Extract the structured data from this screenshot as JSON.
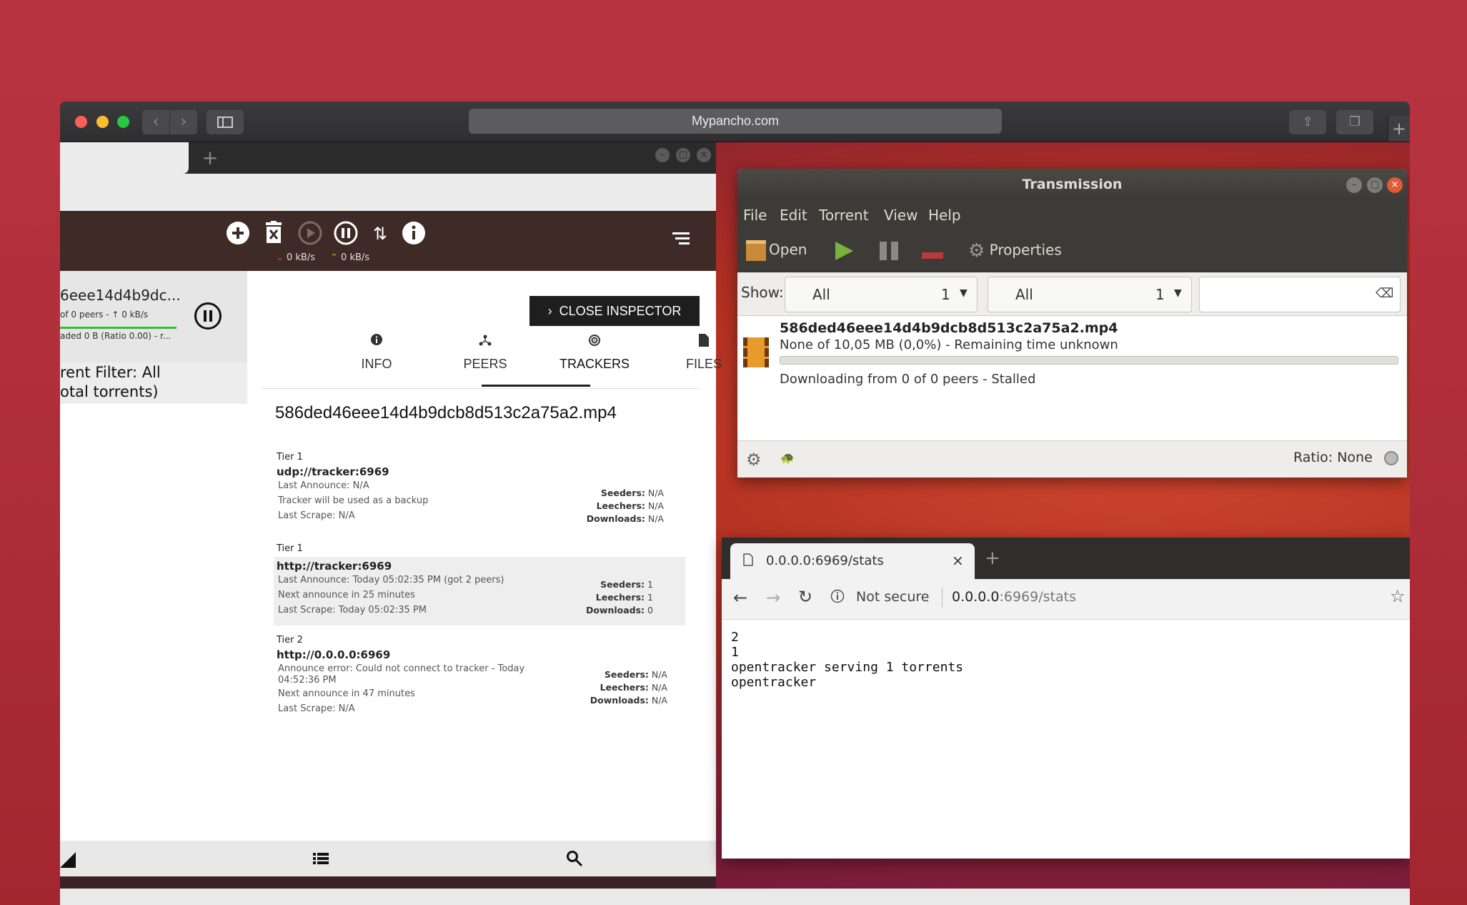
{
  "browser": {
    "url": "Mypancho.com",
    "new_tab": "+"
  },
  "left_app": {
    "tab_plus": "+",
    "toolbar": {
      "download_speed": "0 kB/s",
      "upload_speed": "0 kB/s"
    },
    "torrent": {
      "name": "6eee14d4b9dc...",
      "peers": "of 0 peers - ↑ 0 kB/s",
      "uploaded": "aded 0 B (Ratio 0.00) - r..."
    },
    "filter": {
      "line1": "rent Filter: All",
      "line2": "otal torrents)"
    },
    "inspector": {
      "close_label": "CLOSE INSPECTOR",
      "tabs": [
        "INFO",
        "PEERS",
        "TRACKERS",
        "FILES"
      ],
      "active_tab": "TRACKERS",
      "title": "586ded46eee14d4b9dcb8d513c2a75a2.mp4",
      "trackers": [
        {
          "tier": "Tier 1",
          "url": "udp://tracker:6969",
          "lines": [
            "Last Announce: N/A",
            "Tracker will be used as a backup",
            "Last Scrape: N/A"
          ],
          "seeders": "N/A",
          "leechers": "N/A",
          "downloads": "N/A"
        },
        {
          "tier": "Tier 1",
          "url": "http://tracker:6969",
          "lines": [
            "Last Announce: Today 05:02:35 PM (got 2 peers)",
            "Next announce in 25 minutes",
            "Last Scrape: Today 05:02:35 PM"
          ],
          "seeders": "1",
          "leechers": "1",
          "downloads": "0"
        },
        {
          "tier": "Tier 2",
          "url": "http://0.0.0.0:6969",
          "lines": [
            "Announce error: Could not connect to tracker - Today",
            "04:52:36 PM",
            "Next announce in 47 minutes",
            "Last Scrape: N/A"
          ],
          "seeders": "N/A",
          "leechers": "N/A",
          "downloads": "N/A"
        }
      ],
      "labels": {
        "seeders": "Seeders:",
        "leechers": "Leechers:",
        "downloads": "Downloads:"
      }
    }
  },
  "transmission": {
    "title": "Transmission",
    "menu": [
      "File",
      "Edit",
      "Torrent",
      "View",
      "Help"
    ],
    "toolbar": {
      "open": "Open",
      "properties": "Properties"
    },
    "show_label": "Show:",
    "combo1": {
      "value": "All",
      "count": "1"
    },
    "combo2": {
      "value": "All",
      "count": "1"
    },
    "torrent": {
      "name": "586ded46eee14d4b9dcb8d513c2a75a2.mp4",
      "progress": "None of 10,05 MB (0,0%) - Remaining time unknown",
      "progress_fraction": 0.0,
      "status": "Downloading from 0 of 0 peers - Stalled"
    },
    "ratio": "Ratio: None"
  },
  "chrome": {
    "tab_title": "0.0.0.0:6969/stats",
    "security": "Not secure",
    "url_host": "0.0.0.0",
    "url_rest": ":6969/stats",
    "content_lines": [
      "2",
      "1",
      "opentracker serving 1 torrents",
      "opentracker"
    ]
  },
  "colors": {
    "background": "#b0303c",
    "toolbar_brown": "#3e2a26",
    "progress_green": "#2ec22e"
  }
}
